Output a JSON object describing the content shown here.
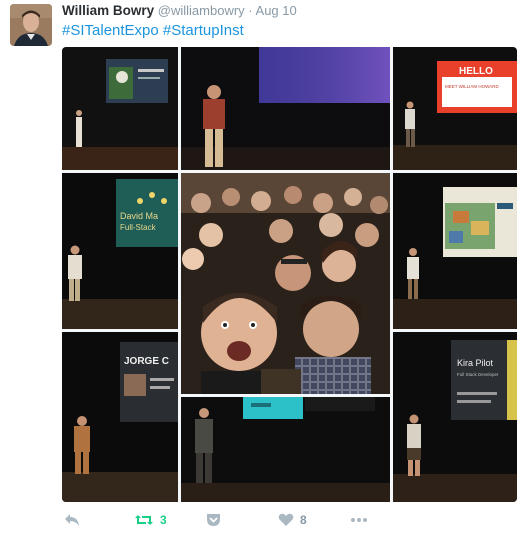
{
  "tweet": {
    "author_name": "William Bowry",
    "author_handle": "@williambowry",
    "separator": "·",
    "timestamp": "Aug 10",
    "hashtags": [
      "#SITalentExpo",
      "#StartupInst"
    ]
  },
  "photos": {
    "slide_texts": {
      "hello": "HELLO",
      "hello_sub": "MEET WILLIAM HOWARD",
      "david": "David Ma",
      "david_sub": "Full-Stack",
      "jorge": "JORGE C",
      "kira": "Kira Pilot",
      "kira_sub": "Full Stack Developer"
    }
  },
  "actions": {
    "reply_icon": "reply-icon",
    "retweet_icon": "retweet-icon",
    "retweet_count": "3",
    "pocket_icon": "pocket-icon",
    "like_icon": "heart-icon",
    "like_count": "8",
    "more_icon": "more-icon"
  },
  "colors": {
    "link": "#1b95e0",
    "retweet_active": "#19cf86",
    "muted": "#8899a6",
    "hello_slide": "#e8402b",
    "accent_slide": "#1f5e57"
  }
}
